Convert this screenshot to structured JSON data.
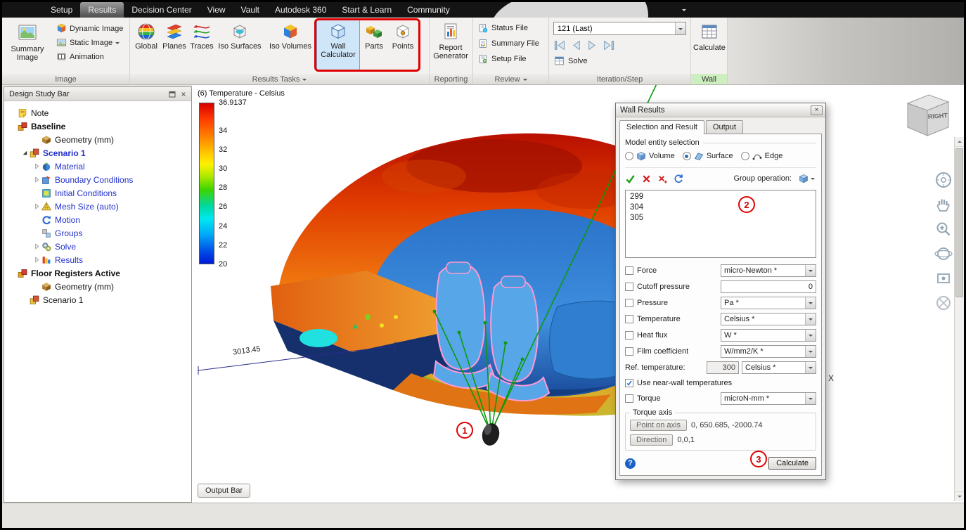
{
  "menubar": {
    "items": [
      {
        "label": "Setup",
        "active": false
      },
      {
        "label": "Results",
        "active": true
      },
      {
        "label": "Decision Center",
        "active": false
      },
      {
        "label": "View",
        "active": false
      },
      {
        "label": "Vault",
        "active": false
      },
      {
        "label": "Autodesk 360",
        "active": false
      },
      {
        "label": "Start & Learn",
        "active": false
      },
      {
        "label": "Community",
        "active": false
      }
    ]
  },
  "ribbon": {
    "image_group": {
      "label": "Image",
      "summary_image": "Summary Image",
      "dynamic_image": "Dynamic Image",
      "static_image": "Static Image",
      "animation": "Animation"
    },
    "results_tasks_group": {
      "label": "Results Tasks",
      "buttons": [
        {
          "label": "Global",
          "icon": "global",
          "selected": false
        },
        {
          "label": "Planes",
          "icon": "planes",
          "selected": false
        },
        {
          "label": "Traces",
          "icon": "traces",
          "selected": false
        },
        {
          "label": "Iso Surfaces",
          "icon": "isoSurfaces",
          "selected": false
        },
        {
          "label": "Iso Volumes",
          "icon": "isoVolumes",
          "selected": false
        },
        {
          "label": "Wall Calculator",
          "icon": "wallCalculator",
          "selected": true
        },
        {
          "label": "Parts",
          "icon": "parts",
          "selected": false
        },
        {
          "label": "Points",
          "icon": "points",
          "selected": false
        }
      ]
    },
    "reporting_group": {
      "label": "Reporting",
      "report_generator": "Report Generator"
    },
    "review_group": {
      "label": "Review",
      "items": [
        {
          "label": "Status File",
          "icon": "statusFile"
        },
        {
          "label": "Summary File",
          "icon": "summaryFile"
        },
        {
          "label": "Setup File",
          "icon": "setupFile"
        }
      ]
    },
    "iteration_group": {
      "label": "Iteration/Step",
      "dropdown_value": "121 (Last)",
      "playback": [
        "step-back",
        "play-back",
        "play-forward",
        "step-forward"
      ],
      "solve": "Solve"
    },
    "wall_group": {
      "label": "Wall",
      "calculate": "Calculate"
    }
  },
  "design_study": {
    "title": "Design Study Bar",
    "items": [
      {
        "label": "Note",
        "indent": 0,
        "icon": "note",
        "bold": false,
        "color": "black",
        "expander": null
      },
      {
        "label": "Baseline",
        "indent": 0,
        "icon": "study",
        "bold": true,
        "color": "black",
        "expander": null
      },
      {
        "label": "Geometry (mm)",
        "indent": 2,
        "icon": "geometry",
        "bold": false,
        "color": "black",
        "expander": null
      },
      {
        "label": "Scenario 1",
        "indent": 1,
        "icon": "scenario",
        "bold": true,
        "color": "blue",
        "expander": "open"
      },
      {
        "label": "Material",
        "indent": 2,
        "icon": "material",
        "bold": false,
        "color": "blue",
        "expander": "closed"
      },
      {
        "label": "Boundary Conditions",
        "indent": 2,
        "icon": "boundary",
        "bold": false,
        "color": "blue",
        "expander": "closed"
      },
      {
        "label": "Initial Conditions",
        "indent": 2,
        "icon": "initial",
        "bold": false,
        "color": "blue",
        "expander": null
      },
      {
        "label": "Mesh Size (auto)",
        "indent": 2,
        "icon": "mesh",
        "bold": false,
        "color": "blue",
        "expander": "closed"
      },
      {
        "label": "Motion",
        "indent": 2,
        "icon": "motion",
        "bold": false,
        "color": "blue",
        "expander": null
      },
      {
        "label": "Groups",
        "indent": 2,
        "icon": "groups",
        "bold": false,
        "color": "blue",
        "expander": null
      },
      {
        "label": "Solve",
        "indent": 2,
        "icon": "solveT",
        "bold": false,
        "color": "blue",
        "expander": "closed"
      },
      {
        "label": "Results",
        "indent": 2,
        "icon": "resultsT",
        "bold": false,
        "color": "blue",
        "expander": "closed"
      },
      {
        "label": "Floor Registers Active",
        "indent": 0,
        "icon": "study",
        "bold": true,
        "color": "black",
        "expander": null
      },
      {
        "label": "Geometry (mm)",
        "indent": 2,
        "icon": "geometry",
        "bold": false,
        "color": "black",
        "expander": null
      },
      {
        "label": "Scenario 1",
        "indent": 1,
        "icon": "scenario",
        "bold": false,
        "color": "black",
        "expander": null
      }
    ]
  },
  "legend": {
    "title": "(6) Temperature - Celsius",
    "ticks": [
      "36.9137",
      "34",
      "32",
      "30",
      "28",
      "26",
      "24",
      "22",
      "20"
    ],
    "max": 36.9137,
    "min": 20
  },
  "viewport": {
    "dimension_label": "3013.45",
    "output_bar_button": "Output Bar",
    "axis_label": "X"
  },
  "navigation": {
    "viewcube_face": "RIGHT",
    "tools": [
      "full-navigation-wheel",
      "pan",
      "zoom",
      "orbit",
      "look-at",
      "navigation-wheel-disabled"
    ]
  },
  "wall_results": {
    "title": "Wall Results",
    "tabs": [
      {
        "label": "Selection and Result",
        "active": true
      },
      {
        "label": "Output",
        "active": false
      }
    ],
    "entity_group_label": "Model entity selection",
    "entity_options": [
      {
        "label": "Volume",
        "icon": "volume",
        "selected": false
      },
      {
        "label": "Surface",
        "icon": "surface",
        "selected": true
      },
      {
        "label": "Edge",
        "icon": "edge",
        "selected": false
      }
    ],
    "group_operation_label": "Group operation:",
    "selection_ids": [
      "299",
      "304",
      "305"
    ],
    "result_rows": [
      {
        "label": "Force",
        "checked": false,
        "unit": "micro-Newton *"
      },
      {
        "label": "Cutoff pressure",
        "checked": false,
        "value": "0"
      },
      {
        "label": "Pressure",
        "checked": false,
        "unit": "Pa *"
      },
      {
        "label": "Temperature",
        "checked": false,
        "unit": "Celsius *"
      },
      {
        "label": "Heat flux",
        "checked": false,
        "unit": "W *"
      },
      {
        "label": "Film coefficient",
        "checked": false,
        "unit": "W/mm2/K *"
      }
    ],
    "ref_temperature": {
      "label": "Ref. temperature:",
      "value": "300",
      "unit": "Celsius *"
    },
    "near_wall": {
      "label": "Use near-wall temperatures",
      "checked": true
    },
    "torque": {
      "label": "Torque",
      "checked": false,
      "unit": "microN-mm *"
    },
    "torque_axis": {
      "group_label": "Torque axis",
      "point_button": "Point on axis",
      "point_value": "0, 650.685, -2000.74",
      "direction_button": "Direction",
      "direction_value": "0,0,1"
    },
    "calculate_button": "Calculate"
  },
  "annotations": [
    {
      "label": "1"
    },
    {
      "label": "2"
    },
    {
      "label": "3"
    }
  ]
}
